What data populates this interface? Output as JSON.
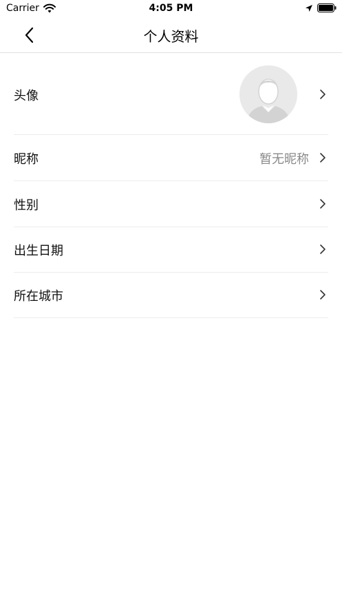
{
  "status_bar": {
    "carrier": "Carrier",
    "time": "4:05 PM"
  },
  "nav": {
    "title": "个人资料",
    "back_icon": "chevron-left-icon"
  },
  "profile": {
    "rows": [
      {
        "label": "头像",
        "value": ""
      },
      {
        "label": "昵称",
        "value": "暂无昵称"
      },
      {
        "label": "性别",
        "value": ""
      },
      {
        "label": "出生日期",
        "value": ""
      },
      {
        "label": "所在城市",
        "value": ""
      }
    ]
  },
  "colors": {
    "divider": "#ececec",
    "value_text": "#8a8a8a",
    "avatar_bg": "#e9e9e9"
  }
}
